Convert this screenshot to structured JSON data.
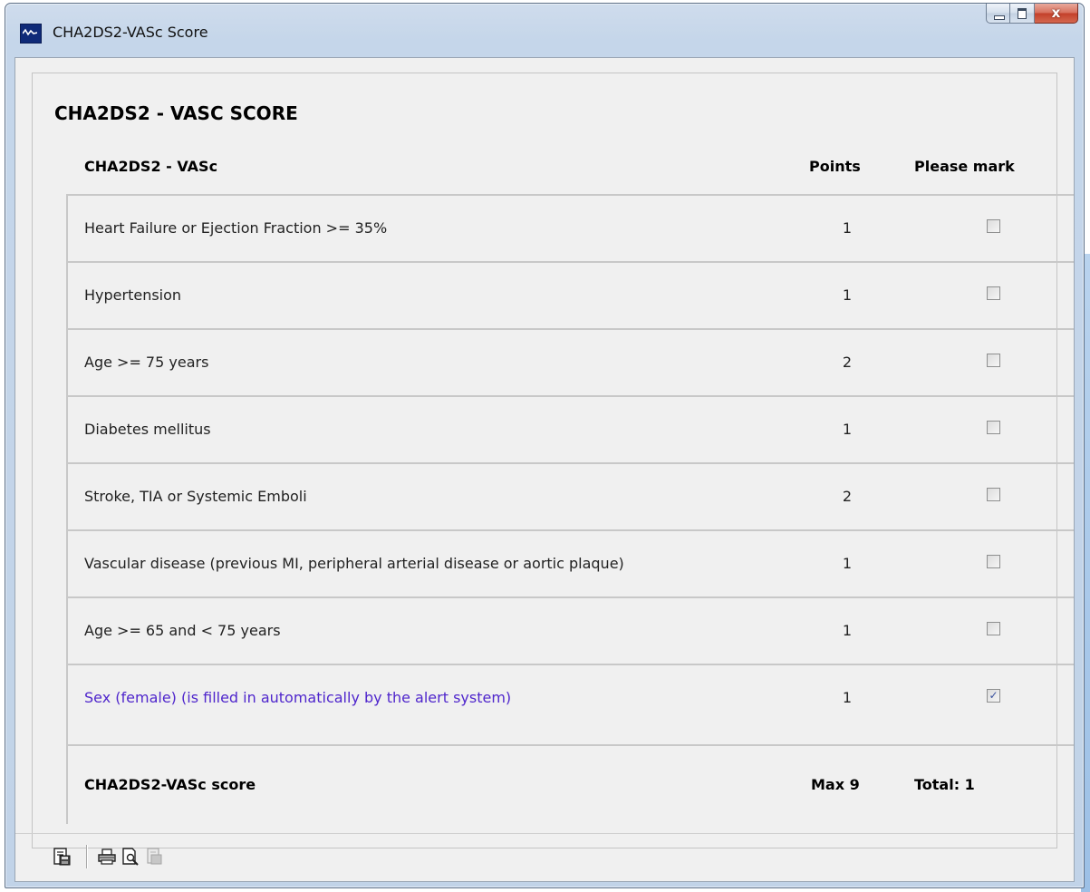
{
  "window": {
    "title": "CHA2DS2-VASc Score",
    "close_label": "x"
  },
  "form": {
    "title": "CHA2DS2 - VASC SCORE",
    "header": {
      "label": "CHA2DS2 - VASc",
      "points": "Points",
      "mark": "Please mark"
    },
    "rows": [
      {
        "label": "Heart Failure or Ejection Fraction >= 35%",
        "points": "1",
        "checked": false
      },
      {
        "label": "Hypertension",
        "points": "1",
        "checked": false
      },
      {
        "label": "Age >= 75 years",
        "points": "2",
        "checked": false
      },
      {
        "label": "Diabetes mellitus",
        "points": "1",
        "checked": false
      },
      {
        "label": "Stroke, TIA or Systemic Emboli",
        "points": "2",
        "checked": false
      },
      {
        "label": "Vascular disease (previous MI, peripheral arterial disease or aortic plaque)",
        "points": "1",
        "checked": false
      },
      {
        "label": "Age >= 65 and < 75 years",
        "points": "1",
        "checked": false
      },
      {
        "label": "Sex (female) (is filled in automatically by the alert system)",
        "points": "1",
        "checked": true
      }
    ],
    "footer": {
      "label": "CHA2DS2-VASc score",
      "max": "Max 9",
      "total": "Total: 1"
    }
  },
  "colors": {
    "auto_row_text": "#4f26cc",
    "window_frame": "#c5d6ea",
    "client_bg": "#f0f0f0"
  },
  "toolbar": {
    "icons": [
      "save-document-icon",
      "print-icon",
      "print-preview-icon",
      "export-icon"
    ]
  }
}
